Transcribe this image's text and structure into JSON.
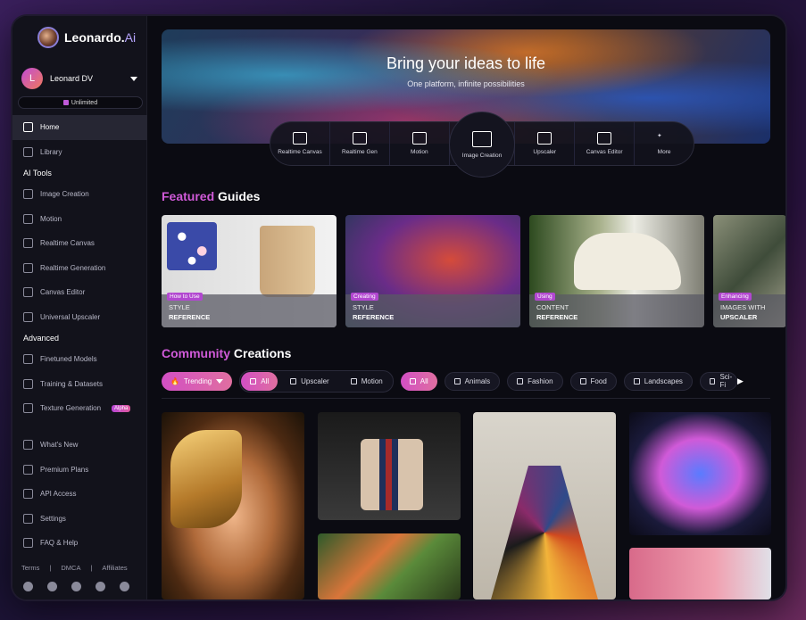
{
  "brand": {
    "name": "Leonardo.",
    "suffix": "Ai"
  },
  "user": {
    "initial": "L",
    "name": "Leonard DV",
    "plan": "Unlimited"
  },
  "nav": {
    "main": [
      {
        "label": "Home",
        "icon": "home-icon",
        "active": true
      },
      {
        "label": "Library",
        "icon": "library-icon"
      }
    ],
    "ai_tools_title": "AI Tools",
    "ai_tools": [
      {
        "label": "Image Creation",
        "icon": "image-icon"
      },
      {
        "label": "Motion",
        "icon": "motion-icon"
      },
      {
        "label": "Realtime Canvas",
        "icon": "canvas-icon"
      },
      {
        "label": "Realtime Generation",
        "icon": "generation-icon"
      },
      {
        "label": "Canvas Editor",
        "icon": "editor-icon"
      },
      {
        "label": "Universal Upscaler",
        "icon": "upscaler-icon"
      }
    ],
    "advanced_title": "Advanced",
    "advanced": [
      {
        "label": "Finetuned Models",
        "icon": "models-icon"
      },
      {
        "label": "Training & Datasets",
        "icon": "training-icon"
      },
      {
        "label": "Texture Generation",
        "icon": "texture-icon",
        "badge": "Alpha"
      }
    ],
    "bottom": [
      {
        "label": "What's New",
        "icon": "bell-icon"
      },
      {
        "label": "Premium Plans",
        "icon": "premium-icon"
      },
      {
        "label": "API Access",
        "icon": "key-icon"
      },
      {
        "label": "Settings",
        "icon": "gear-icon"
      },
      {
        "label": "FAQ & Help",
        "icon": "help-icon"
      }
    ],
    "footer": [
      "Terms",
      "DMCA",
      "Affiliates"
    ],
    "socials": [
      "discord-icon",
      "reddit-icon",
      "x-icon",
      "facebook-icon",
      "apple-icon"
    ]
  },
  "hero": {
    "title": "Bring your ideas to life",
    "subtitle": "One platform, infinite possibilities",
    "tools": [
      {
        "label": "Realtime Canvas"
      },
      {
        "label": "Realtime Gen"
      },
      {
        "label": "Motion"
      },
      {
        "label": "Image Creation",
        "featured": true
      },
      {
        "label": "Upscaler"
      },
      {
        "label": "Canvas Editor"
      },
      {
        "label": "More"
      }
    ]
  },
  "featured": {
    "accent": "Featured",
    "rest": " Guides",
    "cards": [
      {
        "tag": "How to Use",
        "line1": "STYLE",
        "line2": "REFERENCE"
      },
      {
        "tag": "Creating",
        "line1": "STYLE",
        "line2": "REFERENCE"
      },
      {
        "tag": "Using",
        "line1": "CONTENT",
        "line2": "REFERENCE"
      },
      {
        "tag": "Enhancing",
        "line1": "IMAGES WITH",
        "line2": "UPSCALER"
      }
    ]
  },
  "community": {
    "accent": "Community",
    "rest": " Creations",
    "sort": "Trending",
    "type_filters": [
      "All",
      "Upscaler",
      "Motion"
    ],
    "categories": [
      "All",
      "Animals",
      "Fashion",
      "Food",
      "Landscapes",
      "Sci-Fi"
    ]
  },
  "colors": {
    "accent": "#d05ad8",
    "bg": "#0b0b12",
    "sidebar": "#12121b"
  }
}
